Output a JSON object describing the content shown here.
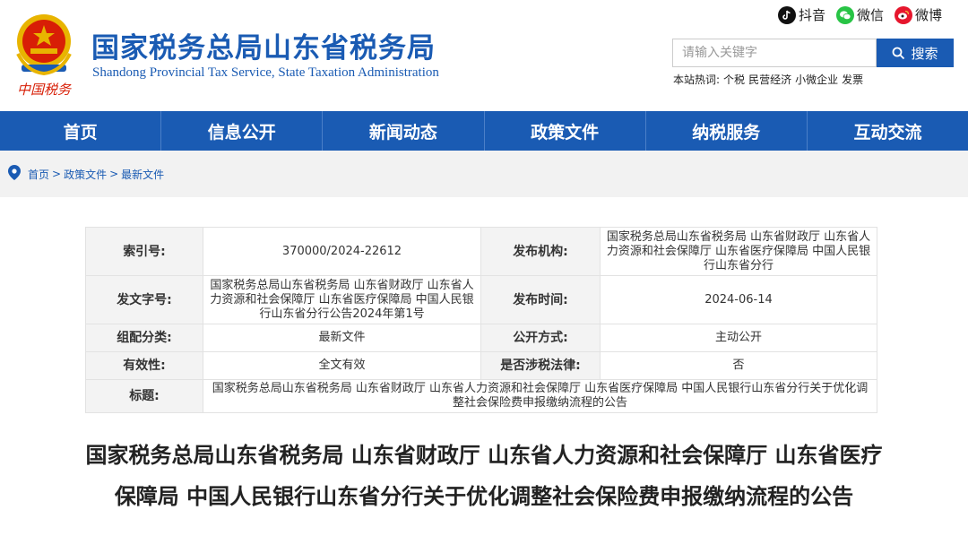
{
  "header": {
    "title_cn": "国家税务总局山东省税务局",
    "title_en": "Shandong Provincial Tax Service, State Taxation Administration",
    "emblem_caption": "中国税务"
  },
  "social": [
    {
      "label": "抖音",
      "icon": "douyin-icon",
      "color": "#111111"
    },
    {
      "label": "微信",
      "icon": "wechat-icon",
      "color": "#28c445"
    },
    {
      "label": "微博",
      "icon": "weibo-icon",
      "color": "#e6162d"
    }
  ],
  "search": {
    "placeholder": "请输入关键字",
    "button_label": "搜索",
    "hot_label": "本站热词:",
    "hot_words": [
      "个税",
      "民营经济",
      "小微企业",
      "发票"
    ]
  },
  "nav": [
    "首页",
    "信息公开",
    "新闻动态",
    "政策文件",
    "纳税服务",
    "互动交流"
  ],
  "breadcrumb": [
    "首页",
    "政策文件",
    "最新文件"
  ],
  "breadcrumb_sep": ">",
  "info": {
    "index_label": "索引号:",
    "index_value": "370000/2024-22612",
    "publisher_label": "发布机构:",
    "publisher_value": "国家税务总局山东省税务局 山东省财政厅 山东省人力资源和社会保障厅 山东省医疗保障局 中国人民银行山东省分行",
    "doc_no_label": "发文字号:",
    "doc_no_value": "国家税务总局山东省税务局 山东省财政厅 山东省人力资源和社会保障厅 山东省医疗保障局 中国人民银行山东省分行公告2024年第1号",
    "date_label": "发布时间:",
    "date_value": "2024-06-14",
    "category_label": "组配分类:",
    "category_value": "最新文件",
    "open_label": "公开方式:",
    "open_value": "主动公开",
    "validity_label": "有效性:",
    "validity_value": "全文有效",
    "taxlaw_label": "是否涉税法律:",
    "taxlaw_value": "否",
    "title_label": "标题:",
    "title_value": "国家税务总局山东省税务局 山东省财政厅 山东省人力资源和社会保障厅 山东省医疗保障局 中国人民银行山东省分行关于优化调整社会保险费申报缴纳流程的公告"
  },
  "article_title": "国家税务总局山东省税务局 山东省财政厅 山东省人力资源和社会保障厅 山东省医疗保障局 中国人民银行山东省分行关于优化调整社会保险费申报缴纳流程的公告",
  "colors": {
    "brand_blue": "#1a5bb3",
    "emblem_red": "#d81e06",
    "emblem_gold": "#e8b400"
  }
}
